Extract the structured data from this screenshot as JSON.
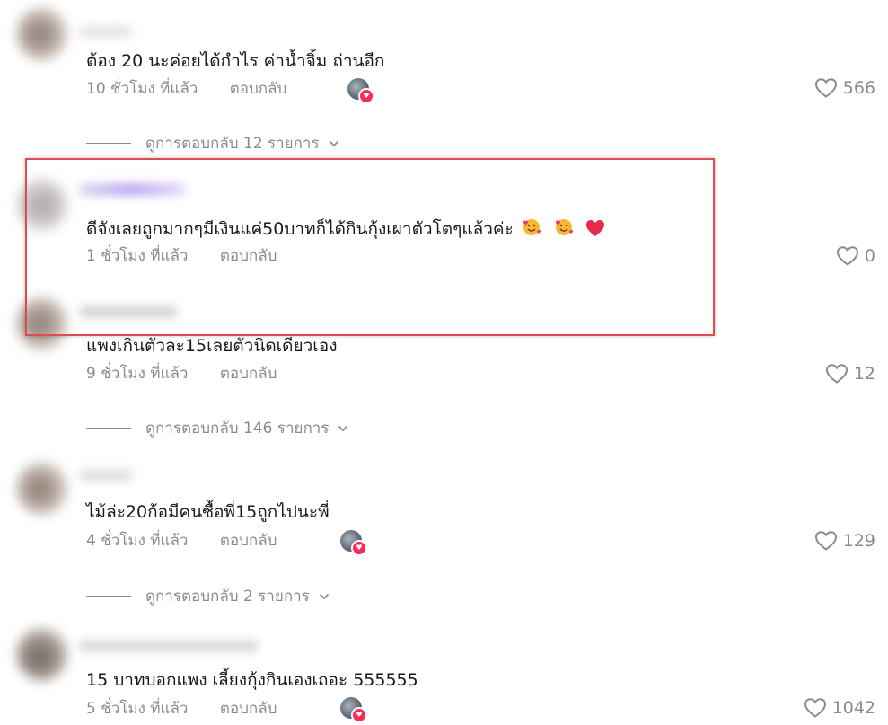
{
  "comments": [
    {
      "text": "ต้อง 20 นะค่อยได้กำไร ค่าน้ำจิ้ม ถ่านอีก",
      "time": "10 ชั่วโมง ที่แล้ว",
      "reply_label": "ตอบกลับ",
      "likes": "566",
      "creator_liked": true,
      "view_replies": "ดูการตอบกลับ 12 รายการ"
    },
    {
      "text": "ดีจังเลยถูกมากๆมีเงินแค่50บาทก็ได้กินกุ้งเผาตัวโตๆแล้วค่ะ",
      "time": "1 ชั่วโมง ที่แล้ว",
      "reply_label": "ตอบกลับ",
      "likes": "0",
      "creator_liked": false,
      "emojis": [
        "smiling-face-with-hearts",
        "smiling-face-with-hearts",
        "red-heart"
      ]
    },
    {
      "text": "แพงเกินตัวละ15เลยตัวนิดเดียวเอง",
      "time": "9 ชั่วโมง ที่แล้ว",
      "reply_label": "ตอบกลับ",
      "likes": "12",
      "creator_liked": false,
      "view_replies": "ดูการตอบกลับ 146 รายการ"
    },
    {
      "text": "ไม้ล่ะ20ก้อมีคนซื้อพี่15ถูกไปนะพี่",
      "time": "4 ชั่วโมง ที่แล้ว",
      "reply_label": "ตอบกลับ",
      "likes": "129",
      "creator_liked": true,
      "view_replies": "ดูการตอบกลับ 2 รายการ"
    },
    {
      "text": "15 บาทบอกแพง เลี้ยงกุ้งกินเองเถอะ 555555",
      "time": "5 ชั่วโมง ที่แล้ว",
      "reply_label": "ตอบกลับ",
      "likes": "1042",
      "creator_liked": true
    }
  ],
  "colors": {
    "highlight_border": "#e04b4b",
    "meta_text": "#8a8b91",
    "badge": "#fe2c55"
  }
}
